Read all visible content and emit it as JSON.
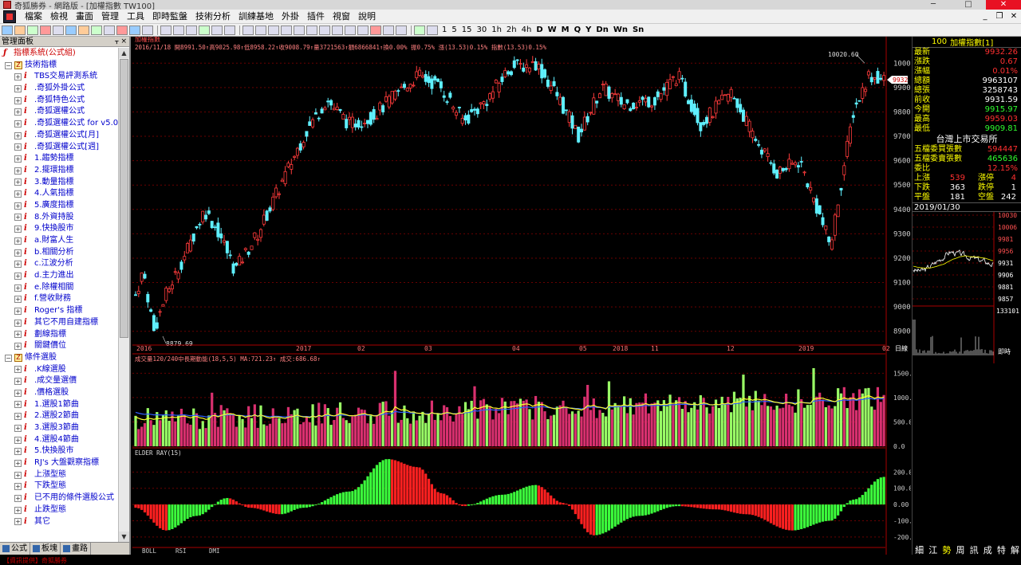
{
  "window": {
    "title": "奇狐勝券 - 網路版 - [加權指數 TW100]"
  },
  "menu": [
    "檔案",
    "檢視",
    "畫面",
    "管理",
    "工具",
    "即時監盤",
    "技術分析",
    "訓練基地",
    "外掛",
    "插件",
    "視窗",
    "說明"
  ],
  "periods": [
    "1",
    "5",
    "15",
    "30",
    "1h",
    "2h",
    "4h",
    "D",
    "W",
    "M",
    "Q",
    "Y",
    "Dn",
    "Wn",
    "Sn"
  ],
  "panel": {
    "title": "管理面板",
    "tree": [
      {
        "label": "指標系統(公式組)",
        "level": 0,
        "kind": "root"
      },
      {
        "label": "技術指標",
        "level": 1,
        "kind": "folder"
      },
      {
        "label": "TBS交易評測系統",
        "level": 2,
        "kind": "item"
      },
      {
        "label": ".奇狐外掛公式",
        "level": 2,
        "kind": "item"
      },
      {
        "label": ".奇狐特色公式",
        "level": 2,
        "kind": "item"
      },
      {
        "label": ".奇狐選權公式",
        "level": 2,
        "kind": "item"
      },
      {
        "label": ".奇狐選權公式 for v5.0",
        "level": 2,
        "kind": "item"
      },
      {
        "label": ".奇狐選權公式[月]",
        "level": 2,
        "kind": "item"
      },
      {
        "label": ".奇狐選權公式[週]",
        "level": 2,
        "kind": "item"
      },
      {
        "label": "1.趨勢指標",
        "level": 2,
        "kind": "item"
      },
      {
        "label": "2.擺環指標",
        "level": 2,
        "kind": "item"
      },
      {
        "label": "3.動量指標",
        "level": 2,
        "kind": "item"
      },
      {
        "label": "4.人氣指標",
        "level": 2,
        "kind": "item"
      },
      {
        "label": "5.廣度指標",
        "level": 2,
        "kind": "item"
      },
      {
        "label": "8.外資持股",
        "level": 2,
        "kind": "item"
      },
      {
        "label": "9.快換股市",
        "level": 2,
        "kind": "item"
      },
      {
        "label": "a.財富人生",
        "level": 2,
        "kind": "item"
      },
      {
        "label": "b.相關分析",
        "level": 2,
        "kind": "item"
      },
      {
        "label": "c.江波分析",
        "level": 2,
        "kind": "item"
      },
      {
        "label": "d.主力進出",
        "level": 2,
        "kind": "item"
      },
      {
        "label": "e.除權相關",
        "level": 2,
        "kind": "item"
      },
      {
        "label": "f.營收財務",
        "level": 2,
        "kind": "item"
      },
      {
        "label": "Roger's 指標",
        "level": 2,
        "kind": "item"
      },
      {
        "label": "其它不用自建指標",
        "level": 2,
        "kind": "item"
      },
      {
        "label": "劃線指標",
        "level": 2,
        "kind": "item"
      },
      {
        "label": "關鍵價位",
        "level": 2,
        "kind": "item"
      },
      {
        "label": "條件選股",
        "level": 1,
        "kind": "folder"
      },
      {
        "label": ".K線選股",
        "level": 2,
        "kind": "item"
      },
      {
        "label": ".成交量選價",
        "level": 2,
        "kind": "item"
      },
      {
        "label": ".價格選股",
        "level": 2,
        "kind": "item"
      },
      {
        "label": "1.選股1節曲",
        "level": 2,
        "kind": "item"
      },
      {
        "label": "2.選股2節曲",
        "level": 2,
        "kind": "item"
      },
      {
        "label": "3.選股3節曲",
        "level": 2,
        "kind": "item"
      },
      {
        "label": "4.選股4節曲",
        "level": 2,
        "kind": "item"
      },
      {
        "label": "5.快換股市",
        "level": 2,
        "kind": "item"
      },
      {
        "label": "RJ's 大盤觀察指標",
        "level": 2,
        "kind": "item"
      },
      {
        "label": "上漲型態",
        "level": 2,
        "kind": "item"
      },
      {
        "label": "下跌型態",
        "level": 2,
        "kind": "item"
      },
      {
        "label": "已不用的條件選股公式",
        "level": 2,
        "kind": "item"
      },
      {
        "label": "止跌型態",
        "level": 2,
        "kind": "item"
      },
      {
        "label": "其它",
        "level": 2,
        "kind": "item"
      }
    ],
    "tabs": [
      "公式",
      "板塊",
      "畫路"
    ]
  },
  "chart": {
    "title": "加權指數",
    "info": "2016/11/18 開8991.50↑高9025.98↑低8958.22↑收9008.79↑量3721563↑額6866841↑換0.00% 振0.75% 漲(13.53)0.15% 指數(13.53)0.15%",
    "price_ticks": [
      "10000",
      "9900",
      "9800",
      "9700",
      "9600",
      "9500",
      "9400",
      "9300",
      "9200",
      "9100",
      "9000",
      "8900"
    ],
    "high_label": "10020.60",
    "low_label": "8879.69",
    "current_tag": "9932",
    "time_labels": [
      "2016",
      "2017",
      "02",
      "03",
      "04",
      "05",
      "2018",
      "11",
      "12",
      "2019",
      "02"
    ],
    "unit_label": "日線",
    "vol_info": "成交量120/240中長期動能(18,5,5) MA:721.23↑ 成交:686.68↑",
    "vol_ticks": [
      "1500.0",
      "1000.0",
      "500.0",
      "0.0"
    ],
    "elder_info": "ELDER RAY(15)",
    "elder_ticks": [
      "200.00",
      "100.00",
      "0.00",
      "-100.0",
      "-200.0"
    ],
    "bottom_tabs": [
      "BOLL",
      "RSI",
      "DMI"
    ],
    "colors": {
      "up": "#ff3b3b",
      "down": "#5ff0ff",
      "vol_up": "#d9306f",
      "vol_down": "#9aff66",
      "ma_yellow": "#ffff30",
      "ma_blue": "#3060ff",
      "elder_up": "#3cff3c",
      "elder_down": "#ff2020",
      "grid": "#6a0000"
    }
  },
  "quote": {
    "code": "100",
    "name": "加權指數[1]",
    "rows": [
      {
        "label": "最新",
        "value": "9932.26",
        "color": "red"
      },
      {
        "label": "漲跌",
        "value": "0.67",
        "color": "red"
      },
      {
        "label": "漲幅",
        "value": "0.01%",
        "color": "red"
      },
      {
        "label": "總額",
        "value": "9963107",
        "color": "white"
      },
      {
        "label": "總張",
        "value": "3258743",
        "color": "white"
      },
      {
        "label": "前收",
        "value": "9931.59",
        "color": "white"
      },
      {
        "label": "今開",
        "value": "9915.97",
        "color": "green"
      },
      {
        "label": "最高",
        "value": "9959.03",
        "color": "red"
      },
      {
        "label": "最低",
        "value": "9909.81",
        "color": "green"
      }
    ],
    "exchange": "台灣上市交易所",
    "rows2": [
      {
        "label": "五檔委買張數",
        "value": "594447",
        "color": "red"
      },
      {
        "label": "五檔委賣張數",
        "value": "465636",
        "color": "green"
      },
      {
        "label": "委比",
        "value": "12.15%",
        "color": "red"
      }
    ],
    "dual": [
      {
        "a": "上漲",
        "b": "539",
        "c": "漲停",
        "d": "4",
        "w": false
      },
      {
        "a": "下跌",
        "b": "363",
        "c": "跌停",
        "d": "1",
        "w": true
      },
      {
        "a": "平盤",
        "b": "181",
        "c": "空盤",
        "d": "242",
        "w": true
      }
    ],
    "date": "2019/01/30",
    "mini_ticks": [
      "10030",
      "10006",
      "9981",
      "9956",
      "9931",
      "9906",
      "9881",
      "9857"
    ],
    "mini_vol_tick": "133101",
    "mini_label": "即時",
    "footer": [
      "細",
      "江",
      "勢",
      "周",
      "訊",
      "成",
      "特",
      "解"
    ]
  },
  "bottom_ticker": "【資訊提供】奇狐勝券"
}
